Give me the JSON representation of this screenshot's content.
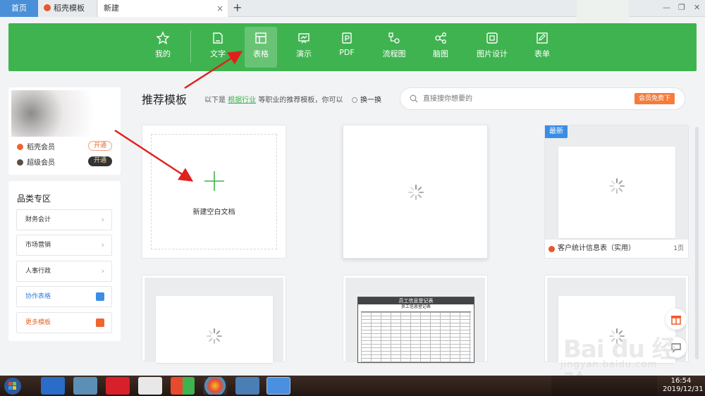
{
  "tabs": {
    "home": "首页",
    "template": "稻壳模板",
    "current": "新建",
    "close": "×",
    "add": "+"
  },
  "window": {
    "minimize": "—",
    "restore": "❐",
    "close": "✕"
  },
  "toolbar": {
    "items": [
      {
        "label": "我的",
        "icon": "star-icon"
      },
      {
        "label": "文字",
        "icon": "document-icon"
      },
      {
        "label": "表格",
        "icon": "table-icon",
        "active": true
      },
      {
        "label": "演示",
        "icon": "presentation-icon"
      },
      {
        "label": "PDF",
        "icon": "pdf-icon"
      },
      {
        "label": "流程图",
        "icon": "flowchart-icon"
      },
      {
        "label": "脑图",
        "icon": "mindmap-icon"
      },
      {
        "label": "图片设计",
        "icon": "image-design-icon"
      },
      {
        "label": "表单",
        "icon": "form-icon"
      }
    ],
    "color": "#3fb34f"
  },
  "user": {
    "vip1": {
      "label": "稻壳会员",
      "button": "开通"
    },
    "vip2": {
      "label": "超级会员",
      "button": "开通"
    }
  },
  "category": {
    "title": "品类专区",
    "items": [
      {
        "label": "财务会计",
        "type": "chevron"
      },
      {
        "label": "市场营销",
        "type": "chevron"
      },
      {
        "label": "人事行政",
        "type": "chevron"
      },
      {
        "label": "协作表格",
        "type": "layers-icon"
      },
      {
        "label": "更多模板",
        "type": "daoke-icon"
      }
    ],
    "chevron": "›"
  },
  "main": {
    "title": "推荐模板",
    "desc_prefix": "以下是",
    "desc_link": "根据行业",
    "desc_suffix": "等职业的推荐模板，你可以",
    "refresh": "换一换",
    "search_placeholder": "直接搜你想要的",
    "search_button": "会员免费下"
  },
  "cards": {
    "new_blank": "新建空白文档",
    "badge_new": "最新",
    "template_title": "客户统计信息表（实用）",
    "template_pages": "1页",
    "sheet_title": "员工信息登记表",
    "sheet_subtitle": "员工信息登记表"
  },
  "watermark": {
    "brand": "Bai du 经验",
    "url": "jingyan.baidu.com"
  },
  "taskbar": {
    "time": "16:54",
    "date": "2019/12/31"
  }
}
